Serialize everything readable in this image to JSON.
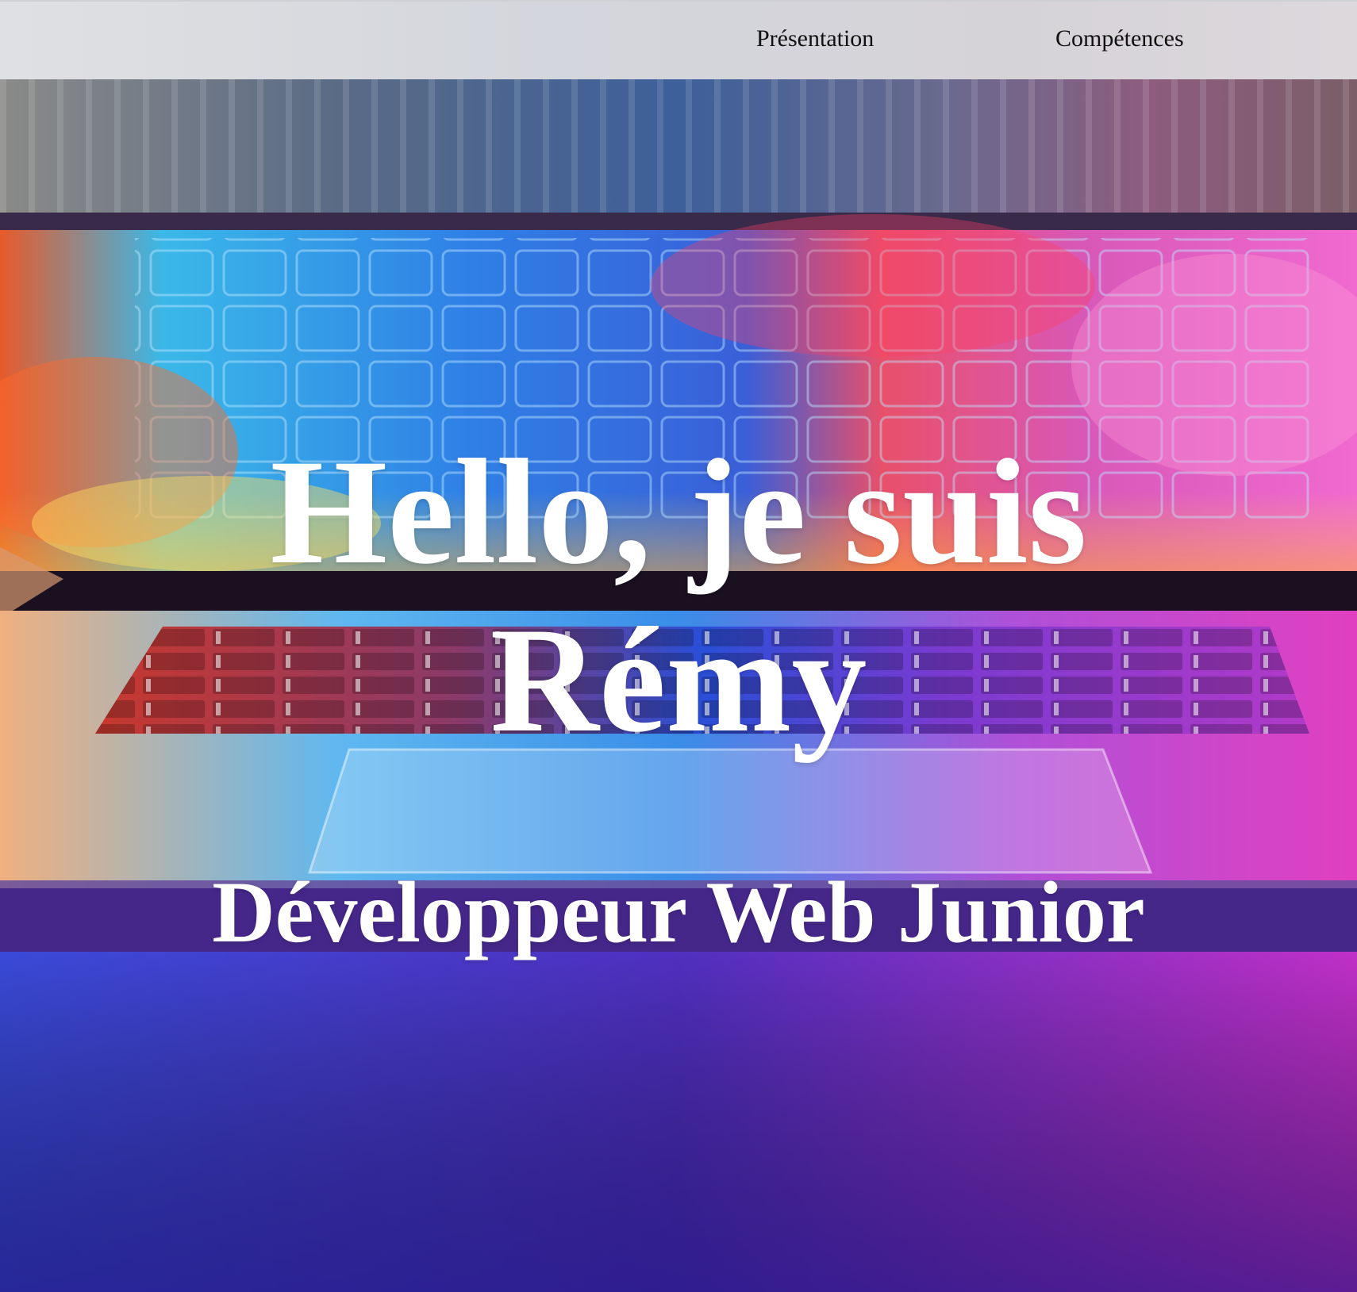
{
  "nav": {
    "items": [
      {
        "label": "Présentation"
      },
      {
        "label": "Compétences"
      }
    ]
  },
  "hero": {
    "title_line1": "Hello, je suis",
    "title_line2": "Rémy",
    "subtitle": "Développeur Web Junior",
    "background_icon": "laptop-keyboard-photo"
  },
  "colors": {
    "navbar_bg": "#d8d9dd",
    "nav_text": "#111111",
    "hero_text": "#ffffff",
    "hero_accent_blue": "#2f6fe0",
    "hero_accent_magenta": "#c22bd0",
    "hero_accent_purple": "#3a1ca0"
  }
}
